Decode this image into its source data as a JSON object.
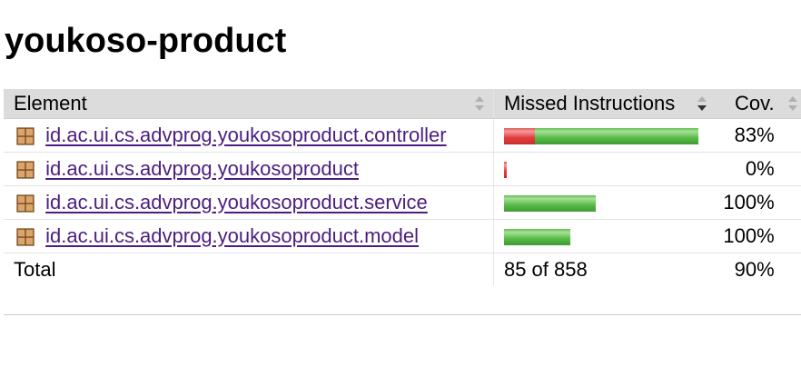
{
  "report": {
    "title": "youkoso-product"
  },
  "table": {
    "columns": [
      {
        "label": "Element"
      },
      {
        "label": "Missed Instructions"
      },
      {
        "label": "Cov."
      }
    ],
    "rows": [
      {
        "name": "id.ac.ui.cs.advprog.youkosoproduct.controller",
        "coverage": "83%",
        "missed_fraction": 0.16,
        "covered_fraction": 0.84,
        "bar_scale": 1.0
      },
      {
        "name": "id.ac.ui.cs.advprog.youkosoproduct",
        "coverage": "0%",
        "missed_fraction": 1.0,
        "covered_fraction": 0.0,
        "bar_scale": 0.014
      },
      {
        "name": "id.ac.ui.cs.advprog.youkosoproduct.service",
        "coverage": "100%",
        "missed_fraction": 0.0,
        "covered_fraction": 1.0,
        "bar_scale": 0.47
      },
      {
        "name": "id.ac.ui.cs.advprog.youkosoproduct.model",
        "coverage": "100%",
        "missed_fraction": 0.0,
        "covered_fraction": 1.0,
        "bar_scale": 0.34
      }
    ],
    "total": {
      "label": "Total",
      "missed_text": "85 of 858",
      "coverage": "90%"
    }
  },
  "colors": {
    "missed": "#e23c3c",
    "covered": "#57bb45",
    "link": "#4b1e7f",
    "header_bg": "#dcdcdc"
  },
  "icons": {
    "package": "package-icon",
    "sort": "sort-icon",
    "sort_desc": "sort-descending-icon"
  }
}
